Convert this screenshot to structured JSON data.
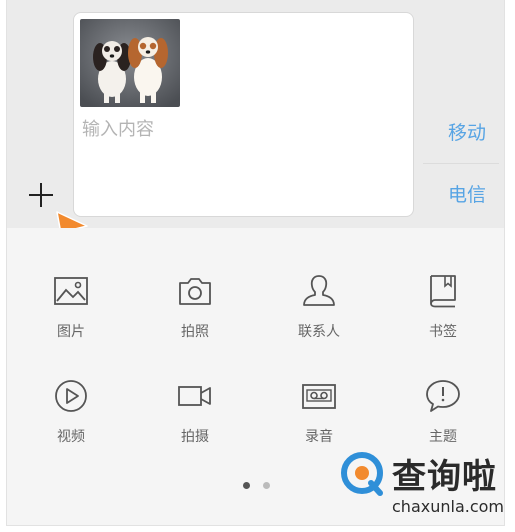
{
  "composer": {
    "input_placeholder": "输入内容",
    "photo": "dogs-photo"
  },
  "carriers": {
    "mobile": "移动",
    "telecom": "电信"
  },
  "tools": [
    {
      "label": "图片",
      "icon": "picture-icon"
    },
    {
      "label": "拍照",
      "icon": "camera-icon"
    },
    {
      "label": "联系人",
      "icon": "contact-icon"
    },
    {
      "label": "书签",
      "icon": "bookmark-icon"
    },
    {
      "label": "视频",
      "icon": "video-play-icon"
    },
    {
      "label": "拍摄",
      "icon": "video-camera-icon"
    },
    {
      "label": "录音",
      "icon": "tape-recorder-icon"
    },
    {
      "label": "主题",
      "icon": "speech-bubble-icon"
    }
  ],
  "pagination": {
    "pages": 2,
    "current": 1
  },
  "watermark": {
    "title": "查询啦",
    "url": "chaxunla.com"
  },
  "colors": {
    "carrier_text": "#57a4e4",
    "cursor": "#f28a2e",
    "watermark_ring": "#2f8fd8",
    "watermark_dot": "#f28a2e"
  }
}
